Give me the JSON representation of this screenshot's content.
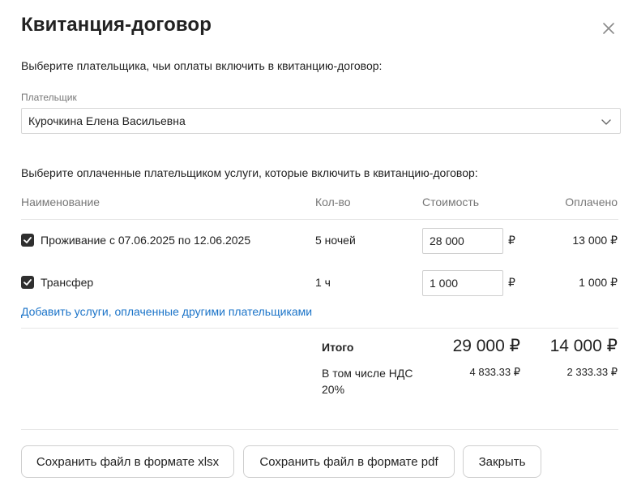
{
  "dialog": {
    "title": "Квитанция-договор",
    "payer_prompt": "Выберите плательщика, чьи оплаты включить в квитанцию-договор:",
    "payer_label": "Плательщик",
    "payer_value": "Курочкина Елена Васильевна",
    "services_prompt": "Выберите оплаченные плательщиком услуги, которые включить в квитанцию-договор:"
  },
  "table": {
    "headers": {
      "name": "Наименование",
      "qty": "Кол-во",
      "cost": "Стоимость",
      "paid": "Оплачено"
    },
    "rows": [
      {
        "checked": true,
        "name": "Проживание с 07.06.2025 по 12.06.2025",
        "qty": "5 ночей",
        "cost": "28 000",
        "currency": "₽",
        "paid": "13 000 ₽"
      },
      {
        "checked": true,
        "name": "Трансфер",
        "qty": "1 ч",
        "cost": "1 000",
        "currency": "₽",
        "paid": "1 000 ₽"
      }
    ]
  },
  "add_link": "Добавить услуги, оплаченные другими плательщиками",
  "summary": {
    "total_label": "Итого",
    "total_cost": "29 000 ₽",
    "total_paid": "14 000 ₽",
    "vat_label": "В том числе НДС 20%",
    "vat_cost": "4 833.33 ₽",
    "vat_paid": "2 333.33 ₽"
  },
  "buttons": {
    "save_xlsx": "Сохранить файл в формате xlsx",
    "save_pdf": "Сохранить файл в формате pdf",
    "close": "Закрыть"
  },
  "icons": {
    "close": "close-icon",
    "chevron": "chevron-down-icon",
    "check": "check-icon"
  },
  "colors": {
    "link": "#1a73c8",
    "checkbox": "#2f2f2f"
  }
}
